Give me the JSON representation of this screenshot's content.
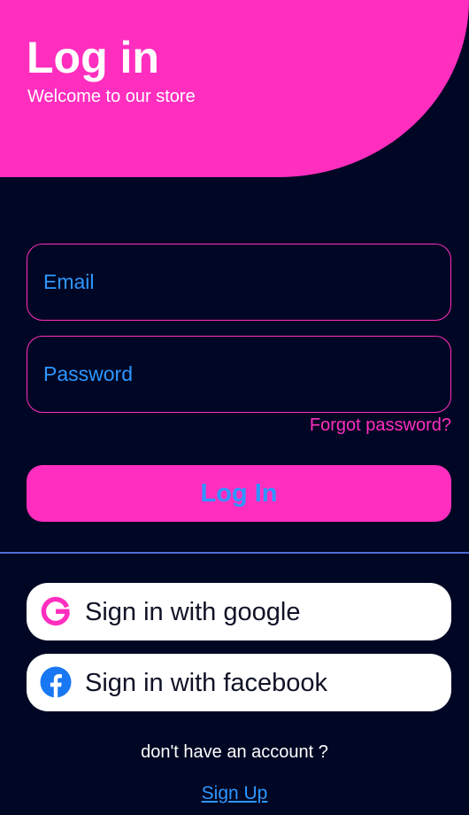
{
  "header": {
    "title": "Log in",
    "subtitle": "Welcome to our store"
  },
  "form": {
    "email_placeholder": "Email",
    "email_value": "",
    "password_placeholder": "Password",
    "password_value": "",
    "forgot_password": "Forgot password?",
    "login_button": "Log In"
  },
  "social": {
    "google_label": "Sign in with google",
    "google_icon": "google-icon",
    "facebook_label": "Sign in with facebook",
    "facebook_icon": "facebook-icon"
  },
  "footer": {
    "prompt": "don't have an account ?",
    "signup_link": "Sign Up"
  },
  "colors": {
    "primary_pink": "#FF2EBF",
    "background": "#000724",
    "accent_blue": "#2E96FF",
    "divider": "#4D6FD6",
    "facebook_blue": "#1877F2"
  }
}
